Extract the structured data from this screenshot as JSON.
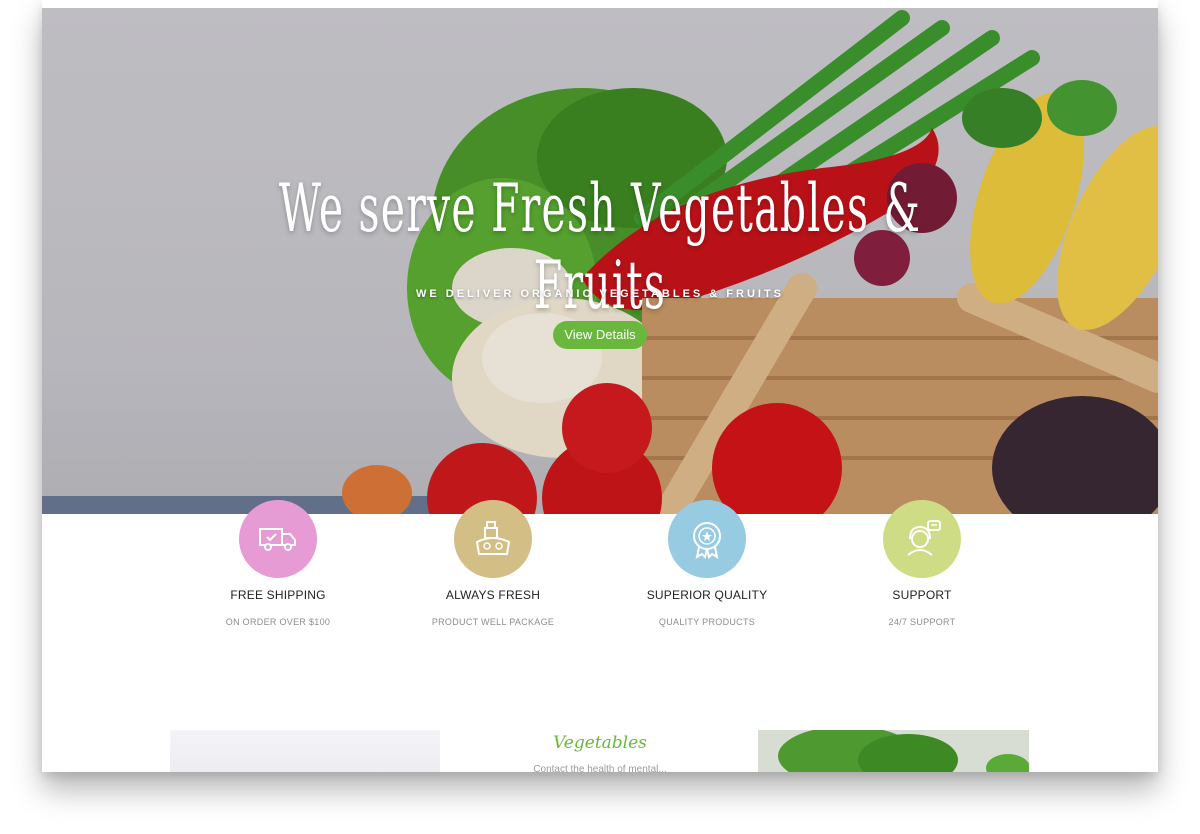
{
  "hero": {
    "title": "We serve Fresh Vegetables & Fruits",
    "subtitle": "WE DELIVER ORGANIC VEGETABLES & FRUITS",
    "button_label": "View Details"
  },
  "features": [
    {
      "title": "FREE SHIPPING",
      "subtitle": "ON ORDER OVER $100",
      "icon": "delivery-truck-icon",
      "color": "#e69bd4"
    },
    {
      "title": "ALWAYS FRESH",
      "subtitle": "PRODUCT WELL PACKAGE",
      "icon": "fresh-produce-icon",
      "color": "#d3bf86"
    },
    {
      "title": "SUPERIOR QUALITY",
      "subtitle": "QUALITY PRODUCTS",
      "icon": "quality-badge-icon",
      "color": "#96cbe2"
    },
    {
      "title": "SUPPORT",
      "subtitle": "24/7 SUPPORT",
      "icon": "support-agent-icon",
      "color": "#cfdc86"
    }
  ],
  "category": {
    "title": "Vegetables",
    "description": "Contact the health of mental..."
  },
  "colors": {
    "accent_green": "#6ab73d",
    "text_dark": "#222222",
    "text_muted": "#8d8d8d"
  }
}
